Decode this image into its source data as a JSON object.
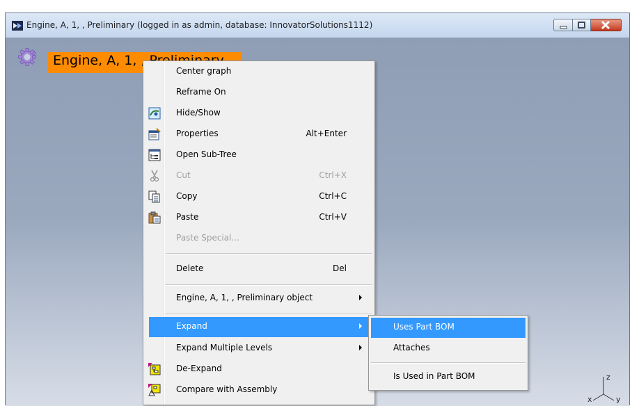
{
  "window": {
    "title": "Engine, A, 1, , Preliminary (logged in as admin, database: InnovatorSolutions1112)",
    "app_icon": "aras-window-icon"
  },
  "graph": {
    "node_label": "Engine, A, 1, , Preliminary",
    "node_color": "#ff8c00",
    "node_icon": "gear-icon",
    "axis_labels": {
      "x": "x",
      "y": "y",
      "z": "z"
    }
  },
  "context_menu": {
    "items": [
      {
        "label": "Center graph",
        "accel": "",
        "icon": "",
        "disabled": false
      },
      {
        "label": "Reframe On",
        "accel": "",
        "icon": "",
        "disabled": false
      },
      {
        "label": "Hide/Show",
        "accel": "",
        "icon": "hide-show-icon",
        "disabled": false
      },
      {
        "label": "Properties",
        "accel": "Alt+Enter",
        "icon": "properties-icon",
        "disabled": false
      },
      {
        "label": "Open Sub-Tree",
        "accel": "",
        "icon": "tree-icon",
        "disabled": false
      },
      {
        "label": "Cut",
        "accel": "Ctrl+X",
        "icon": "scissors-icon",
        "disabled": true
      },
      {
        "label": "Copy",
        "accel": "Ctrl+C",
        "icon": "copy-icon",
        "disabled": false
      },
      {
        "label": "Paste",
        "accel": "Ctrl+V",
        "icon": "paste-icon",
        "disabled": false
      },
      {
        "label": "Paste Special...",
        "accel": "",
        "icon": "",
        "disabled": true
      },
      {
        "label": "Delete",
        "accel": "Del",
        "icon": "",
        "disabled": false
      },
      {
        "label": "Engine, A, 1, , Preliminary object",
        "accel": "",
        "icon": "",
        "disabled": false,
        "submenu": true
      },
      {
        "label": "Expand",
        "accel": "",
        "icon": "",
        "disabled": false,
        "submenu": true,
        "highlighted": true
      },
      {
        "label": "Expand Multiple Levels",
        "accel": "",
        "icon": "",
        "disabled": false,
        "submenu": true
      },
      {
        "label": "De-Expand",
        "accel": "",
        "icon": "de-expand-icon",
        "disabled": false
      },
      {
        "label": "Compare with Assembly",
        "accel": "",
        "icon": "compare-assembly-icon",
        "disabled": false
      }
    ]
  },
  "expand_submenu": {
    "items": [
      {
        "label": "Uses Part BOM",
        "highlighted": true
      },
      {
        "label": "Attaches"
      },
      {
        "label": "Is Used in Part BOM"
      }
    ]
  },
  "colors": {
    "highlight": "#3399ff",
    "menu_bg": "#f0f0f0",
    "canvas_top": "#8f9db5"
  }
}
